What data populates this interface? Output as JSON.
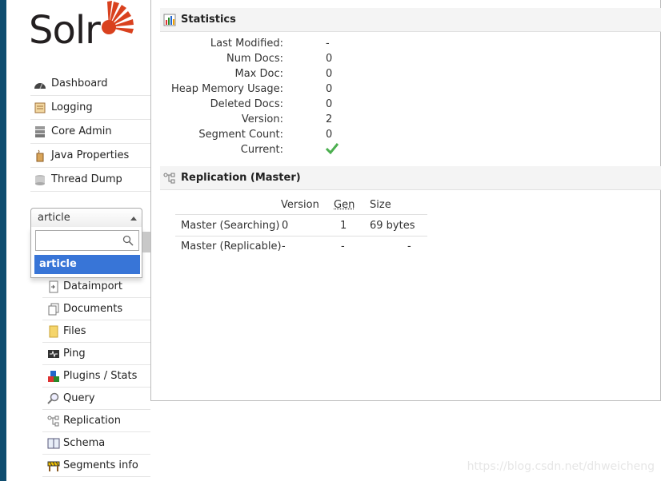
{
  "logo": {
    "text": "Solr"
  },
  "nav": [
    {
      "label": "Dashboard",
      "icon": "dashboard-icon"
    },
    {
      "label": "Logging",
      "icon": "logging-icon"
    },
    {
      "label": "Core Admin",
      "icon": "core-admin-icon"
    },
    {
      "label": "Java Properties",
      "icon": "java-icon"
    },
    {
      "label": "Thread Dump",
      "icon": "thread-dump-icon"
    }
  ],
  "core_selector": {
    "selected": "article",
    "search_value": "",
    "options": [
      "article"
    ]
  },
  "core_nav": [
    {
      "label": "Dataimport",
      "icon": "dataimport-icon"
    },
    {
      "label": "Documents",
      "icon": "documents-icon"
    },
    {
      "label": "Files",
      "icon": "files-icon"
    },
    {
      "label": "Ping",
      "icon": "ping-icon"
    },
    {
      "label": "Plugins / Stats",
      "icon": "plugins-icon"
    },
    {
      "label": "Query",
      "icon": "query-icon"
    },
    {
      "label": "Replication",
      "icon": "replication-icon"
    },
    {
      "label": "Schema",
      "icon": "schema-icon"
    },
    {
      "label": "Segments info",
      "icon": "segments-icon"
    }
  ],
  "statistics": {
    "title": "Statistics",
    "rows": [
      {
        "label": "Last Modified:",
        "value": "-"
      },
      {
        "label": "Num Docs:",
        "value": "0"
      },
      {
        "label": "Max Doc:",
        "value": "0"
      },
      {
        "label": "Heap Memory Usage:",
        "value": "0"
      },
      {
        "label": "Deleted Docs:",
        "value": "0"
      },
      {
        "label": "Version:",
        "value": "2"
      },
      {
        "label": "Segment Count:",
        "value": "0"
      },
      {
        "label": "Current:",
        "value": ""
      }
    ]
  },
  "replication": {
    "title": "Replication (Master)",
    "columns": [
      "Version",
      "Gen",
      "Size"
    ],
    "rows": [
      {
        "name": "Master (Searching)",
        "version": "0",
        "gen": "1",
        "size": "69 bytes"
      },
      {
        "name": "Master (Replicable)",
        "version": "-",
        "gen": "-",
        "size": "-"
      }
    ]
  },
  "watermark": "https://blog.csdn.net/dhweicheng",
  "colors": {
    "sidebar_strip": "#0f4d6f",
    "selected_option": "#3875d7",
    "logo_rays": "#d9411e",
    "check": "#4caf50"
  }
}
